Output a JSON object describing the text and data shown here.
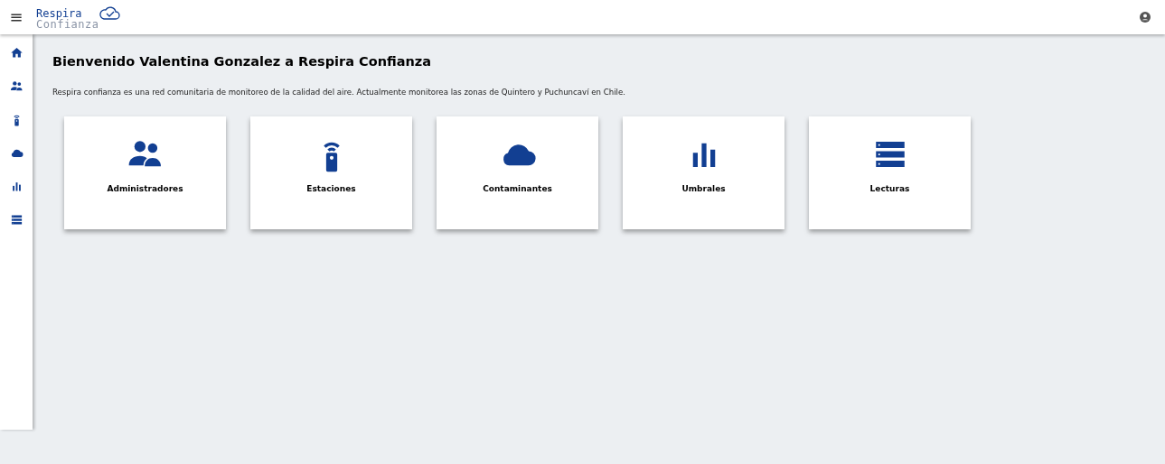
{
  "header": {
    "menu_icon": "≡",
    "logo": {
      "line_1": "Respira",
      "line_2": "Confianza"
    }
  },
  "sidebar": {
    "items": [
      {
        "kind": "home"
      },
      {
        "kind": "people"
      },
      {
        "kind": "station"
      },
      {
        "kind": "cloud"
      },
      {
        "kind": "bars"
      },
      {
        "kind": "list"
      }
    ]
  },
  "main": {
    "title": "Bienvenido Valentina Gonzalez a Respira Confianza",
    "description": "Respira confianza es una red comunitaria de monitoreo de la calidad del aire. Actualmente monitorea las zonas de Quintero y Puchuncaví en Chile.",
    "cards": [
      {
        "kind": "people",
        "label": "Administradores"
      },
      {
        "kind": "station",
        "label": "Estaciones"
      },
      {
        "kind": "cloud",
        "label": "Contaminantes"
      },
      {
        "kind": "bars",
        "label": "Umbrales"
      },
      {
        "kind": "list",
        "label": "Lecturas"
      }
    ]
  }
}
